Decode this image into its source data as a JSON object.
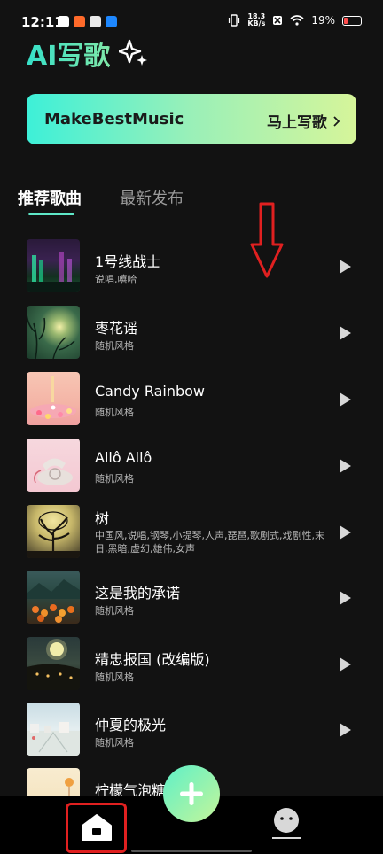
{
  "status_bar": {
    "time": "12:11",
    "net_speed_value": "18.3",
    "net_speed_unit": "KB/s",
    "battery": "19%",
    "battery_level": 0.19,
    "colors": {
      "battery_low": "#ff4d4d"
    }
  },
  "header": {
    "title": "AI写歌",
    "sparkle_icon": "sparkle-icon"
  },
  "banner": {
    "brand": "MakeBestMusic",
    "cta": "马上写歌",
    "cta_icon": "chevron-right-icon"
  },
  "tabs": [
    {
      "label": "推荐歌曲",
      "active": true
    },
    {
      "label": "最新发布",
      "active": false
    }
  ],
  "songs": [
    {
      "title": "1号线战士",
      "tags": "说唱,嘻哈"
    },
    {
      "title": "枣花谣",
      "tags": "随机风格"
    },
    {
      "title": "Candy Rainbow",
      "tags": "随机风格"
    },
    {
      "title": "Allô Allô",
      "tags": "随机风格"
    },
    {
      "title": "树",
      "tags": "中国风,说唱,钢琴,小提琴,人声,琵琶,歌剧式,戏剧性,末日,黑暗,虚幻,雄伟,女声"
    },
    {
      "title": "这是我的承诺",
      "tags": "随机风格"
    },
    {
      "title": "精忠报国 (改编版)",
      "tags": "随机风格"
    },
    {
      "title": "仲夏的极光",
      "tags": "随机风格"
    },
    {
      "title": "柠檬气泡糖",
      "tags": ""
    }
  ],
  "bottom_nav": {
    "home_icon": "home-icon",
    "create_icon": "plus-icon",
    "profile_icon": "profile-icon"
  },
  "colors": {
    "accent_teal": "#36e0c8",
    "accent_lime": "#d6f59a",
    "annotation_red": "#e02020"
  }
}
